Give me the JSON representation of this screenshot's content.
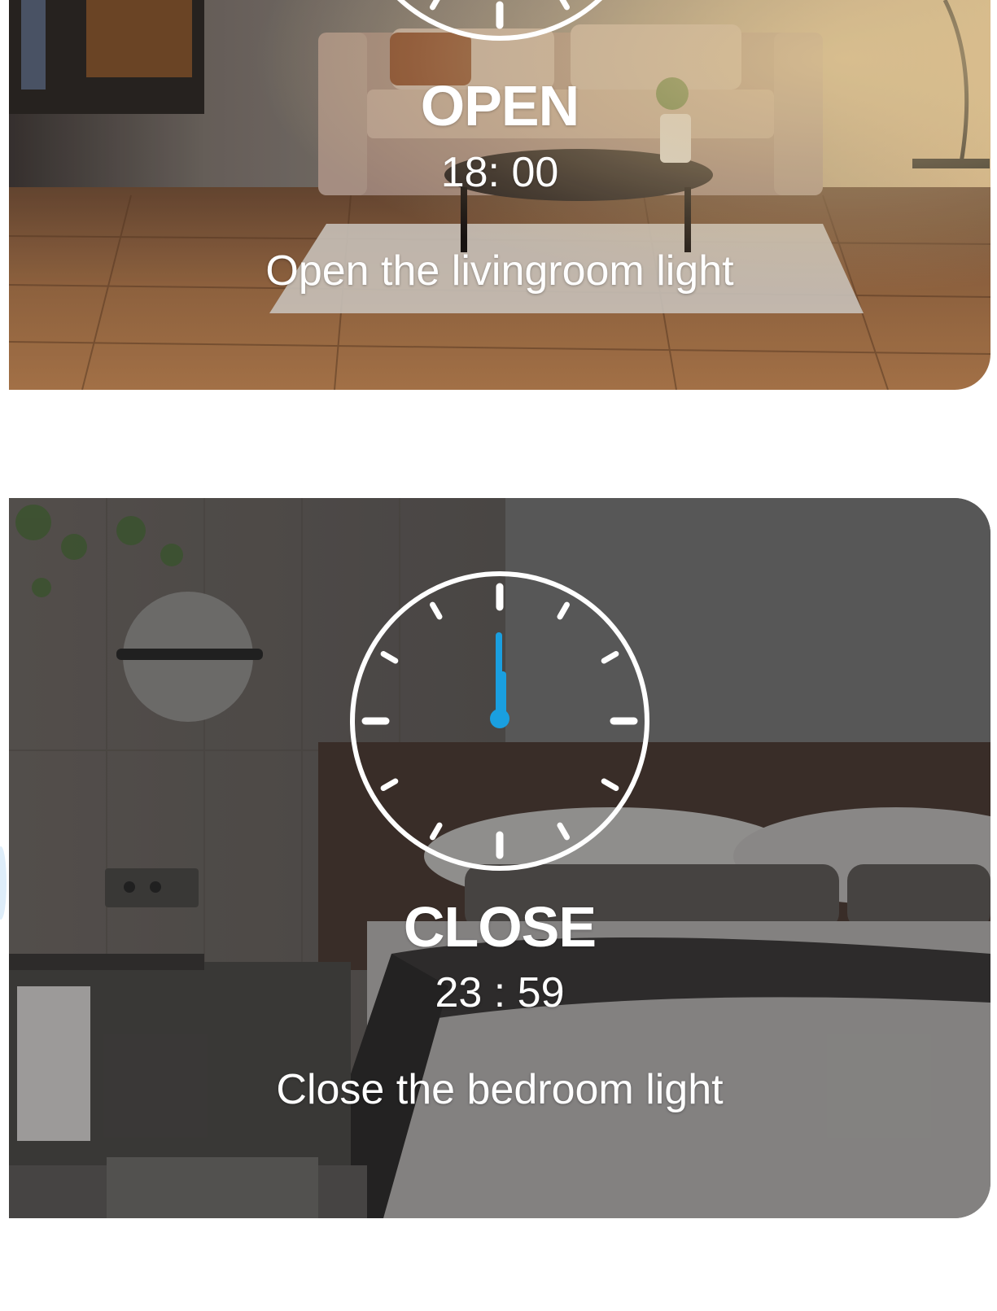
{
  "schedules": [
    {
      "action": "OPEN",
      "time": "18: 00",
      "description": "Open the livingroom light",
      "clock_icon": "clock-icon"
    },
    {
      "action": "CLOSE",
      "time": "23 : 59",
      "description": "Close the bedroom light",
      "clock_icon": "clock-icon",
      "hand_color": "#1a9fe0"
    }
  ]
}
